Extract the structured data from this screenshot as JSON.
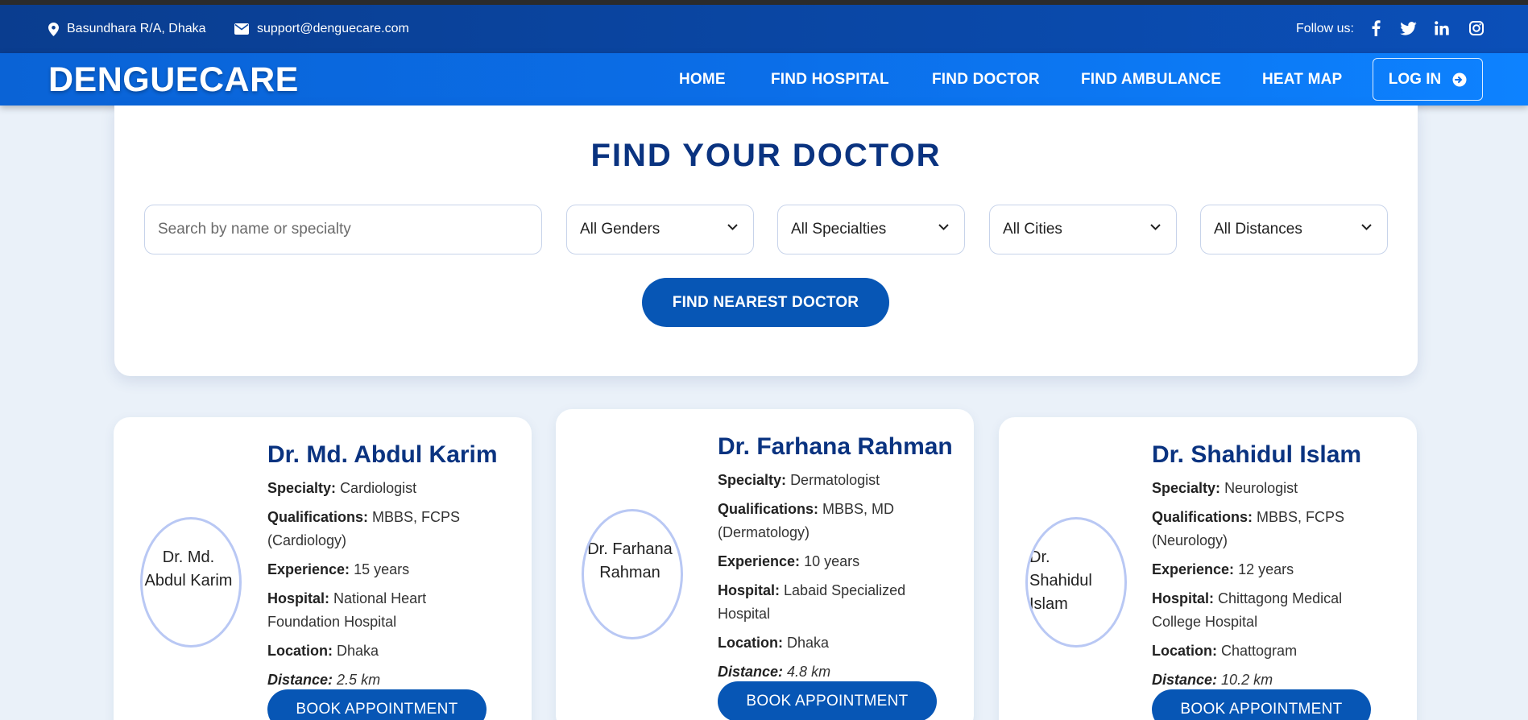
{
  "topbar": {
    "address": "Basundhara R/A, Dhaka",
    "email": "support@denguecare.com",
    "follow_label": "Follow us:",
    "social_icons": [
      "facebook-icon",
      "twitter-icon",
      "linkedin-icon",
      "instagram-icon"
    ]
  },
  "nav": {
    "logo": "DENGUECARE",
    "links": [
      "HOME",
      "FIND HOSPITAL",
      "FIND DOCTOR",
      "FIND AMBULANCE",
      "HEAT MAP"
    ],
    "login": "LOG IN"
  },
  "search": {
    "title": "FIND YOUR DOCTOR",
    "placeholder": "Search by name or specialty",
    "gender": "All Genders",
    "specialty": "All Specialties",
    "city": "All Cities",
    "distance": "All Distances",
    "button": "FIND NEAREST DOCTOR"
  },
  "labels": {
    "specialty": "Specialty:",
    "qualifications": "Qualifications:",
    "experience": "Experience:",
    "hospital": "Hospital:",
    "location": "Location:",
    "distance": "Distance:",
    "book": "BOOK APPOINTMENT"
  },
  "doctors": [
    {
      "avatar_alt": "Dr. Md.\nAbdul Karim",
      "name": "Dr. Md. Abdul Karim",
      "specialty": "Cardiologist",
      "qualifications": "MBBS, FCPS (Cardiology)",
      "experience": "15 years",
      "hospital": "National Heart Foundation Hospital",
      "location": "Dhaka",
      "distance": "2.5 km"
    },
    {
      "avatar_alt": "Dr. Farhana\nRahman",
      "name": "Dr. Farhana Rahman",
      "specialty": "Dermatologist",
      "qualifications": "MBBS, MD (Dermatology)",
      "experience": "10 years",
      "hospital": "Labaid Specialized Hospital",
      "location": "Dhaka",
      "distance": "4.8 km"
    },
    {
      "avatar_alt": "Dr.\nShahidul\nIslam",
      "name": "Dr. Shahidul Islam",
      "specialty": "Neurologist",
      "qualifications": "MBBS, FCPS (Neurology)",
      "experience": "12 years",
      "hospital": "Chittagong Medical College Hospital",
      "location": "Chattogram",
      "distance": "10.2 km"
    }
  ]
}
